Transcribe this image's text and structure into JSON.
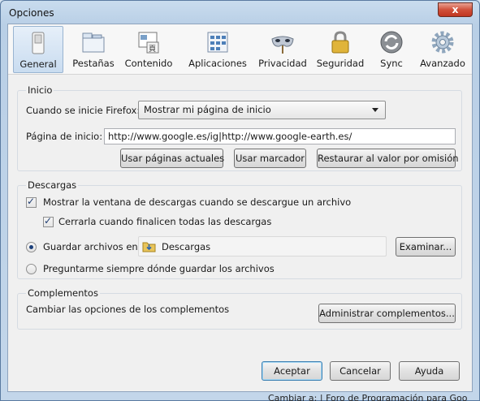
{
  "window": {
    "title": "Opciones",
    "close_glyph": "x"
  },
  "toolbar": [
    {
      "label": "General",
      "icon": "switch-icon",
      "selected": true
    },
    {
      "label": "Pestañas",
      "icon": "tabs-icon"
    },
    {
      "label": "Contenido",
      "icon": "content-icon"
    },
    {
      "label": "Aplicaciones",
      "icon": "applications-icon"
    },
    {
      "label": "Privacidad",
      "icon": "mask-icon"
    },
    {
      "label": "Seguridad",
      "icon": "padlock-icon"
    },
    {
      "label": "Sync",
      "icon": "sync-icon"
    },
    {
      "label": "Avanzado",
      "icon": "gear-icon"
    }
  ],
  "inicio": {
    "title": "Inicio",
    "startup_label": "Cuando se inicie Firefox:",
    "startup_value": "Mostrar mi página de inicio",
    "homepage_label": "Página de inicio:",
    "homepage_value": "http://www.google.es/ig|http://www.google-earth.es/",
    "btn_current": "Usar páginas actuales",
    "btn_bookmark": "Usar marcador",
    "btn_restore": "Restaurar al valor por omisión"
  },
  "descargas": {
    "title": "Descargas",
    "show_window": {
      "label": "Mostrar la ventana de descargas cuando se descargue un archivo",
      "checked": true
    },
    "close_when_done": {
      "label": "Cerrarla cuando finalicen todas las descargas",
      "checked": true
    },
    "save_to": {
      "label": "Guardar archivos en",
      "selected": true
    },
    "folder": "Descargas",
    "btn_browse": "Examinar...",
    "ask_always": {
      "label": "Preguntarme siempre dónde guardar los archivos",
      "selected": false
    }
  },
  "complementos": {
    "title": "Complementos",
    "description": "Cambiar las opciones de los complementos",
    "btn_manage": "Administrar complementos..."
  },
  "footer": {
    "ok": "Aceptar",
    "cancel": "Cancelar",
    "help": "Ayuda"
  },
  "background_text": "Cambiar a: | Foro de Programación para Goo",
  "colors": {
    "accent": "#3c7fb1",
    "close": "#c03520",
    "frame": "#b9cfe6"
  }
}
